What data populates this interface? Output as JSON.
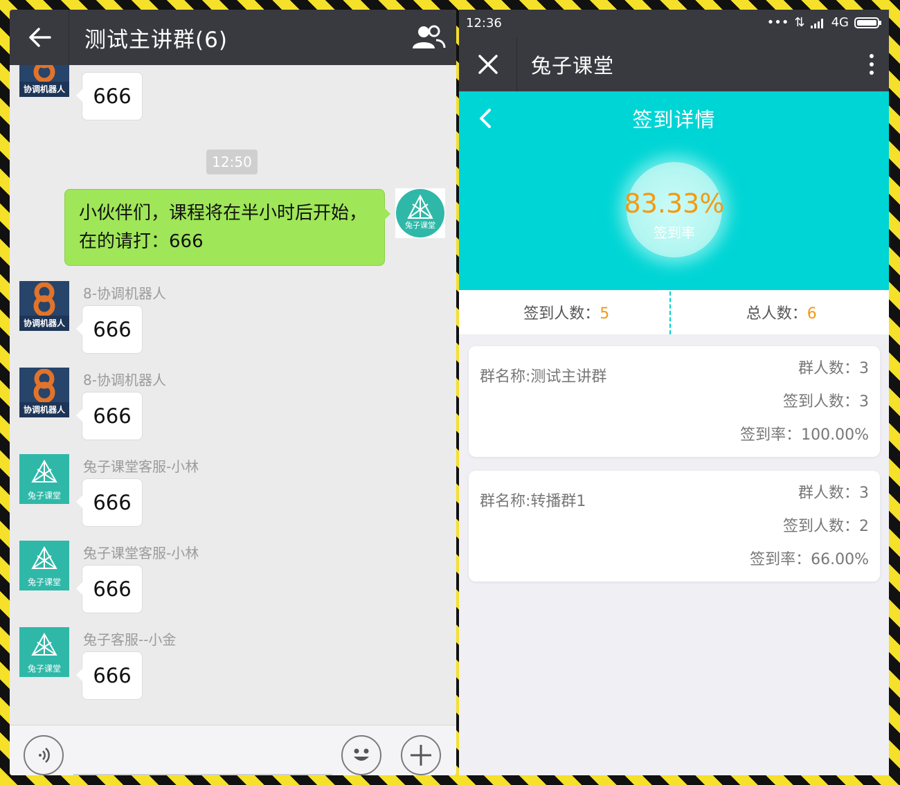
{
  "left": {
    "title": "测试主讲群(6)",
    "timestamp": "12:50",
    "top_message": {
      "text": "666",
      "avatar_caption": "协调机器人"
    },
    "self_message": {
      "line1": "小伙伴们，课程将在半小时后开始，",
      "line2": "在的请打：666",
      "avatar_caption": "兔子课堂"
    },
    "messages": [
      {
        "sender": "8-协调机器人",
        "text": "666",
        "avatar_caption": "协调机器人"
      },
      {
        "sender": "8-协调机器人",
        "text": "666",
        "avatar_caption": "协调机器人"
      },
      {
        "sender": "兔子课堂客服-小林",
        "text": "666",
        "avatar_caption": "兔子课堂"
      },
      {
        "sender": "兔子课堂客服-小林",
        "text": "666",
        "avatar_caption": "兔子课堂"
      },
      {
        "sender": "兔子客服--小金",
        "text": "666",
        "avatar_caption": "兔子课堂"
      }
    ],
    "icons": [
      "back-arrow-icon",
      "group-members-icon",
      "voice-icon",
      "emoji-icon",
      "plus-icon"
    ]
  },
  "right": {
    "status_time": "12:36",
    "status_network": "4G",
    "app_title": "兔子课堂",
    "page_title": "签到详情",
    "rate_value": "83.33%",
    "rate_label": "签到率",
    "signed_label": "签到人数：",
    "signed_value": "5",
    "total_label": "总人数：",
    "total_value": "6",
    "groups": [
      {
        "name": "群名称:测试主讲群",
        "members": "群人数：3",
        "signed": "签到人数：3",
        "rate": "签到率：100.00%"
      },
      {
        "name": "群名称:转播群1",
        "members": "群人数：3",
        "signed": "签到人数：2",
        "rate": "签到率：66.00%"
      }
    ],
    "accent_color": "#00d5d5",
    "highlight_color": "#f39a12"
  }
}
